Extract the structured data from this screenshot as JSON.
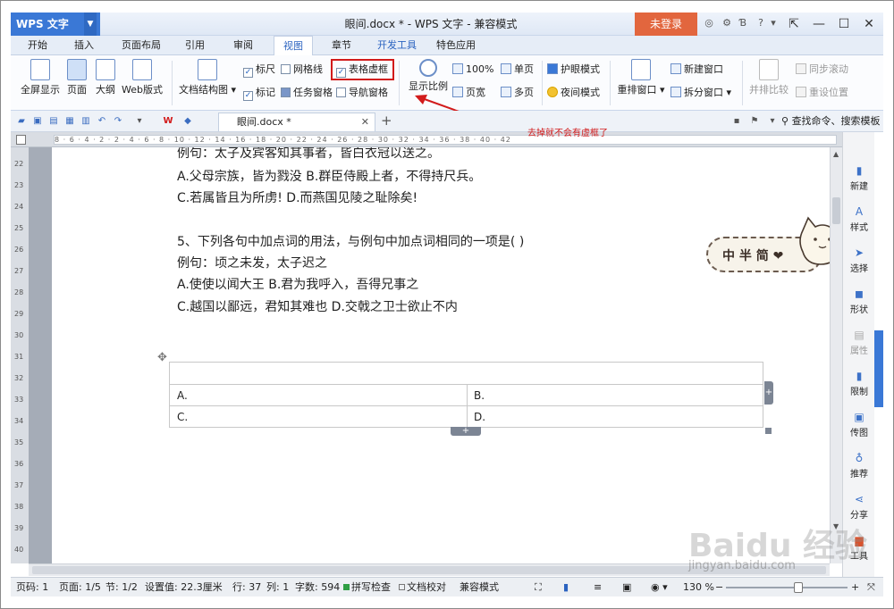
{
  "app": {
    "name": "WPS 文字",
    "title": "眼间.docx * - WPS 文字 - 兼容模式",
    "login": "未登录"
  },
  "tabs": [
    "开始",
    "插入",
    "页面布局",
    "引用",
    "审阅",
    "视图",
    "章节",
    "开发工具",
    "特色应用"
  ],
  "ribbon": {
    "big": [
      "全屏显示",
      "页面",
      "大纲",
      "Web版式",
      "文档结构图",
      "显示比例",
      "重排窗口",
      "并排比较"
    ],
    "checks": {
      "ruler": "标尺",
      "grid": "网格线",
      "table_borders": "表格虚框",
      "marks": "标记",
      "taskpane": "任务窗格",
      "navpane": "导航窗格"
    },
    "zoom100": "100%",
    "single": "单页",
    "pagewidth": "页宽",
    "multi": "多页",
    "eyecare": "护眼模式",
    "night": "夜间模式",
    "newwin": "新建窗口",
    "split": "拆分窗口",
    "sync": "同步滚动",
    "resetpos": "重设位置"
  },
  "annotation": "去掉就不会有虚框了",
  "doc_tab": "眼间.docx *",
  "search": "查找命令、搜索模板",
  "ruler_text": "8 · 6 · 4 · 2 · 2 · 4 · 6 · 8 · 10 · 12 · 14 · 16 · 18 · 20 · 22 · 24 · 26 · 28 · 30 · 32 · 34 · 36 · 38 · 40 · 42",
  "vruler": [
    "22",
    "23",
    "24",
    "25",
    "26",
    "27",
    "28",
    "29",
    "30",
    "31",
    "32",
    "33",
    "34",
    "35",
    "36",
    "37",
    "38",
    "39",
    "40"
  ],
  "doc": {
    "lines": [
      "例句：太子及宾客知其事者，皆白衣冠以送之。",
      "A.父母宗族，皆为戮没  B.群臣侍殿上者，不得持尺兵。",
      "C.若属皆且为所虏! D.而燕国见陵之耻除矣!",
      "5、下列各句中加点词的用法，与例句中加点词相同的一项是( )",
      "例句：顷之未发，太子迟之",
      "A.使使以闻大王 B.君为我呼入，吾得兄事之",
      "C.越国以鄙远，君知其难也 D.交戟之卫士欲止不内"
    ],
    "table": {
      "a": "A.",
      "b": "B.",
      "c": "C.",
      "d": "D."
    }
  },
  "sticker": "中 半 简 ❤",
  "rpanel": [
    "新建",
    "样式",
    "选择",
    "形状",
    "属性",
    "限制",
    "传图",
    "推荐",
    "分享",
    "工具"
  ],
  "status": {
    "page": "页码: 1",
    "pages": "页面: 1/5",
    "section": "节: 1/2",
    "setting": "设置值: 22.3厘米",
    "row": "行: 37",
    "col": "列: 1",
    "words": "字数: 594",
    "spell": "拼写检查",
    "proof": "文档校对",
    "compat": "兼容模式",
    "zoom": "130 %"
  },
  "watermark": "Baidu 经验",
  "watermark_url": "jingyan.baidu.com"
}
